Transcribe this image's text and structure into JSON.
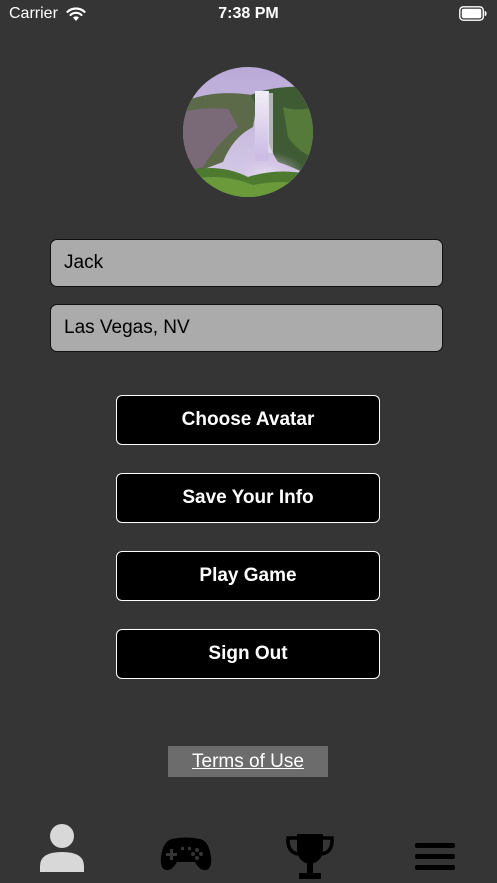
{
  "status_bar": {
    "carrier": "Carrier",
    "time": "7:38 PM"
  },
  "profile": {
    "name_value": "Jack",
    "location_value": "Las Vegas, NV"
  },
  "buttons": {
    "choose_avatar": "Choose Avatar",
    "save_info": "Save Your Info",
    "play_game": "Play Game",
    "sign_out": "Sign Out"
  },
  "terms_link": "Terms of Use",
  "tabbar": {
    "icons": [
      "person-icon",
      "gamepad-icon",
      "trophy-icon",
      "menu-icon"
    ],
    "active_color": "#d8d8d8",
    "inactive_color": "#000000"
  },
  "colors": {
    "background": "#353535",
    "field_background": "#ababab",
    "button_background": "#000000",
    "terms_background": "#6c6c6c"
  }
}
